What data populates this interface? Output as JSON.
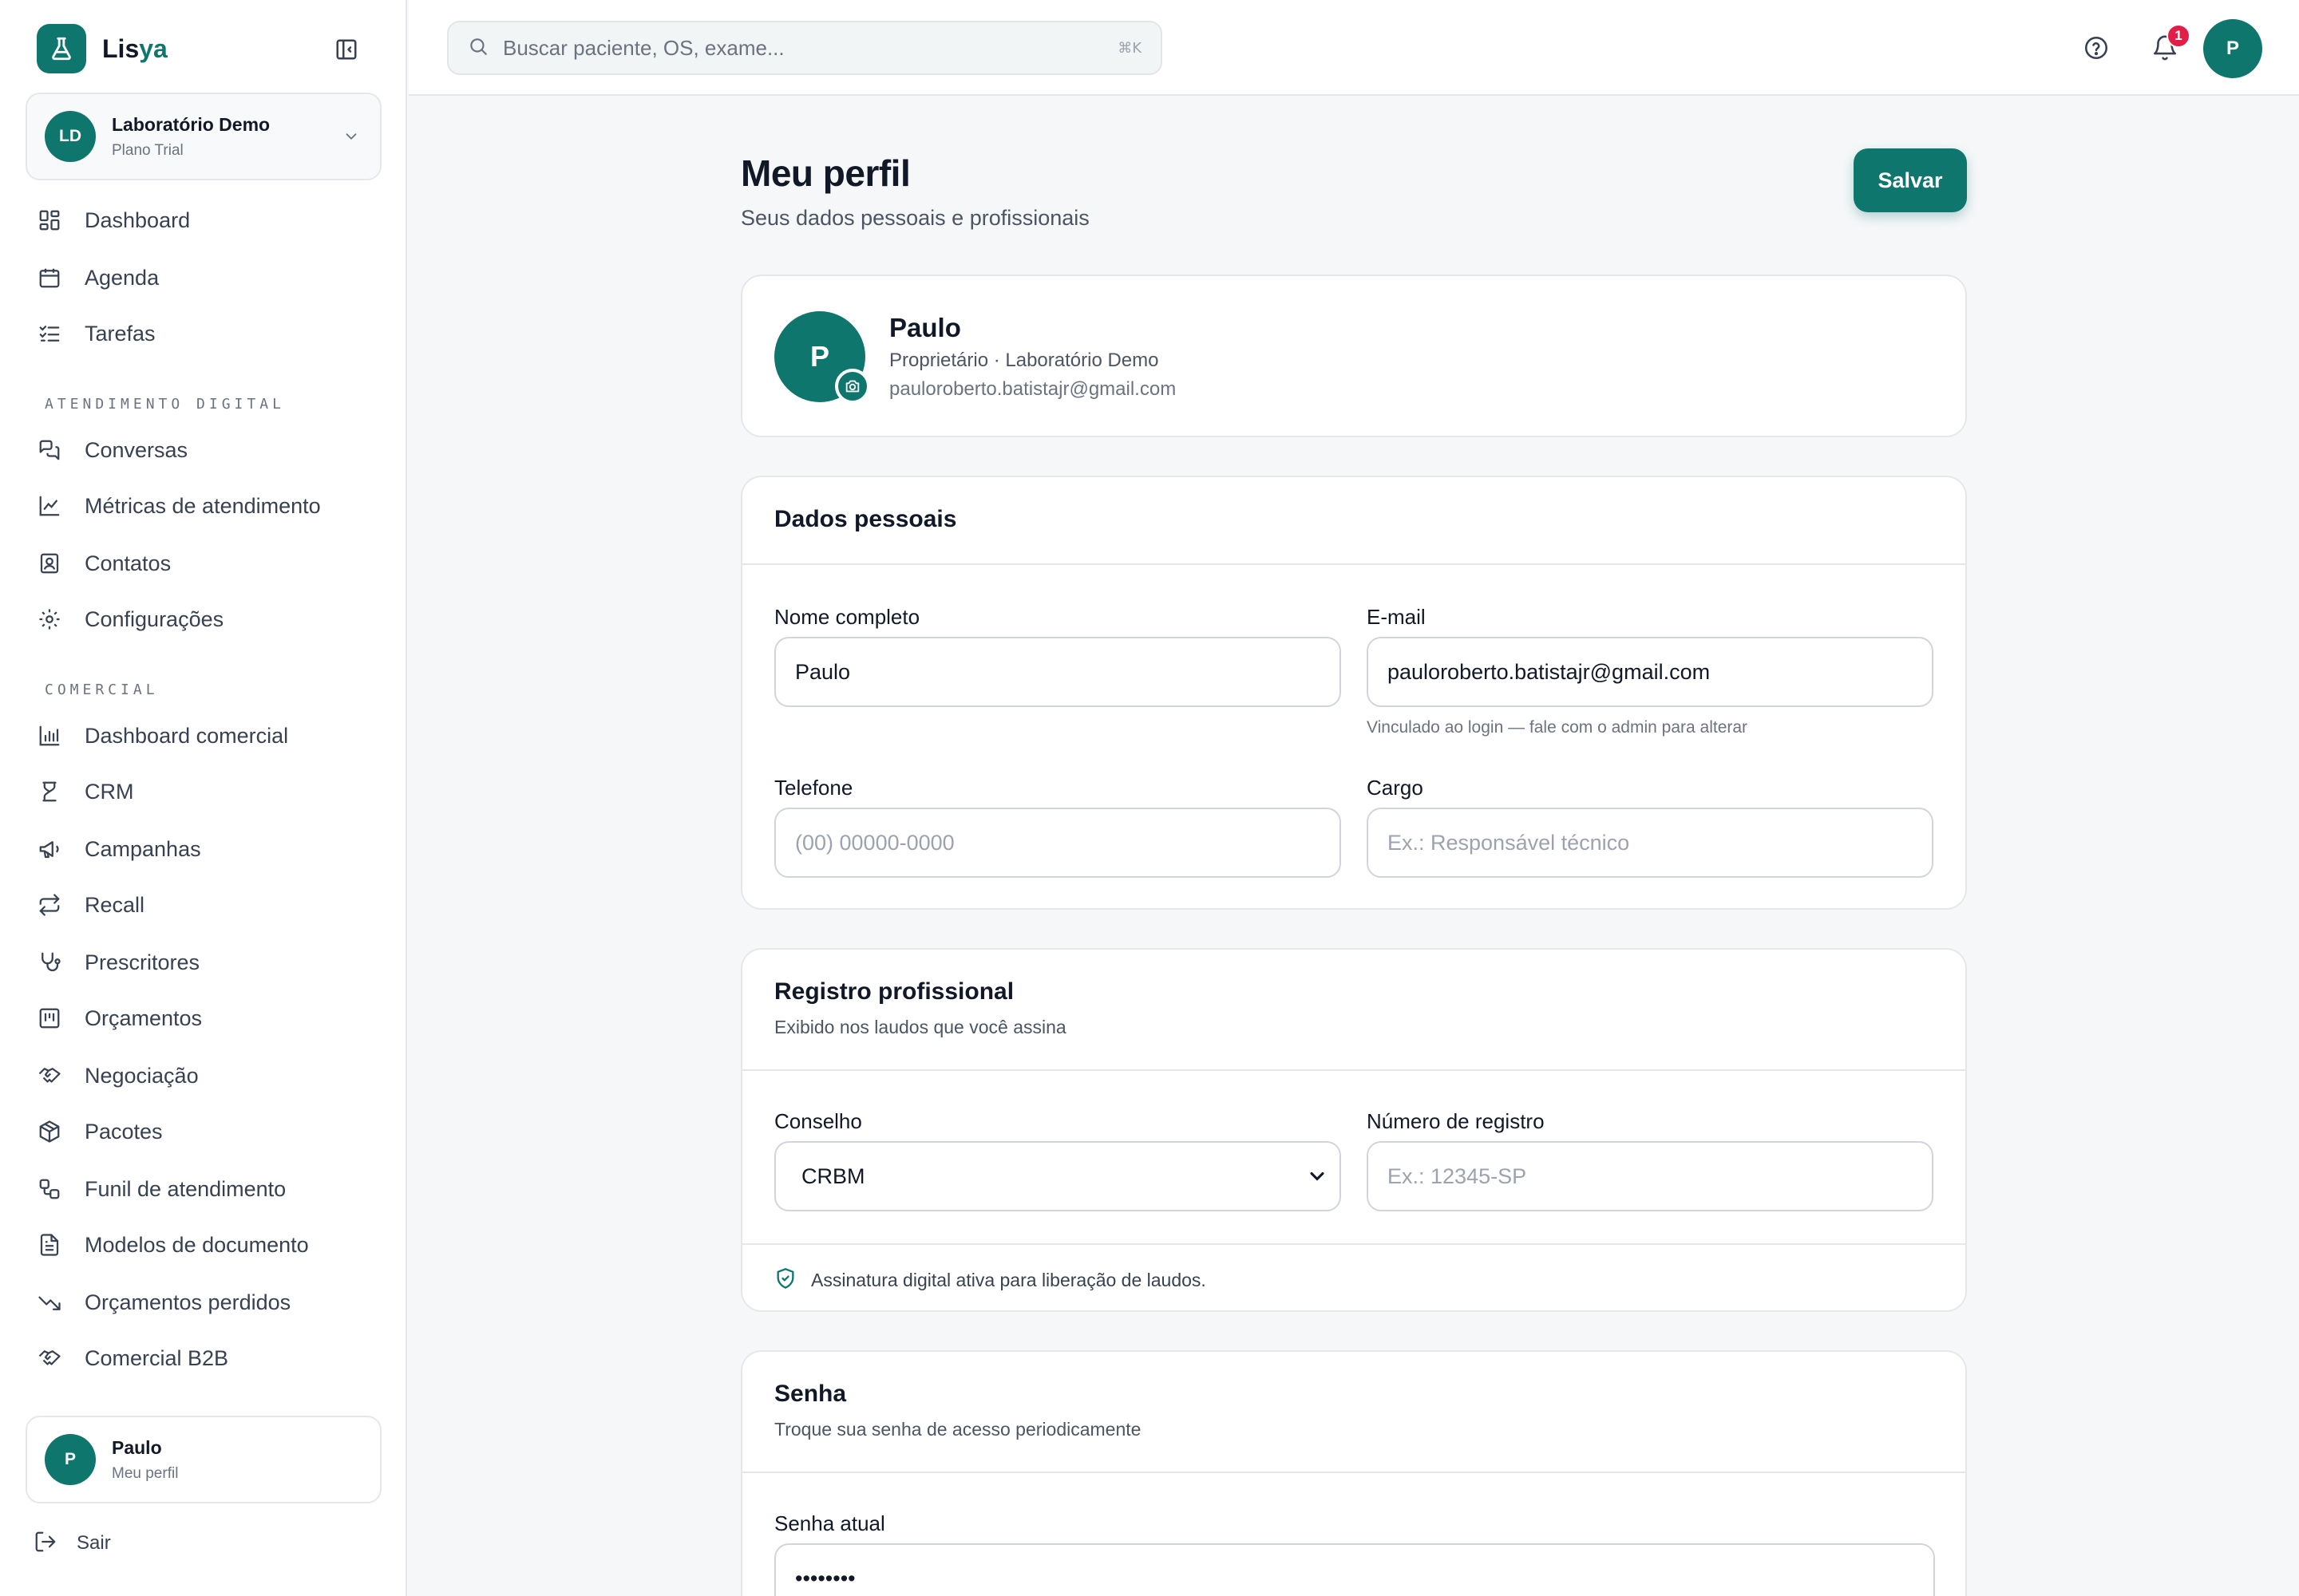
{
  "brand": {
    "name_main": "Lis",
    "name_accent": "ya"
  },
  "org": {
    "initials": "LD",
    "name": "Laboratório Demo",
    "plan": "Plano Trial"
  },
  "nav": {
    "top": [
      {
        "label": "Dashboard",
        "icon": "grid-icon"
      },
      {
        "label": "Agenda",
        "icon": "calendar-icon"
      },
      {
        "label": "Tarefas",
        "icon": "checklist-icon"
      }
    ],
    "section_digital": "ATENDIMENTO DIGITAL",
    "digital": [
      {
        "label": "Conversas",
        "icon": "chat-icon"
      },
      {
        "label": "Métricas de atendimento",
        "icon": "line-chart-icon"
      },
      {
        "label": "Contatos",
        "icon": "contact-icon"
      },
      {
        "label": "Configurações",
        "icon": "gear-icon"
      }
    ],
    "section_comercial": "COMERCIAL",
    "comercial": [
      {
        "label": "Dashboard comercial",
        "icon": "bar-chart-icon"
      },
      {
        "label": "CRM",
        "icon": "crm-icon"
      },
      {
        "label": "Campanhas",
        "icon": "megaphone-icon"
      },
      {
        "label": "Recall",
        "icon": "repeat-icon"
      },
      {
        "label": "Prescritores",
        "icon": "stethoscope-icon"
      },
      {
        "label": "Orçamentos",
        "icon": "receipt-icon"
      },
      {
        "label": "Negociação",
        "icon": "handshake-icon"
      },
      {
        "label": "Pacotes",
        "icon": "package-icon"
      },
      {
        "label": "Funil de atendimento",
        "icon": "workflow-icon"
      },
      {
        "label": "Modelos de documento",
        "icon": "document-icon"
      },
      {
        "label": "Orçamentos perdidos",
        "icon": "trending-down-icon"
      },
      {
        "label": "Comercial B2B",
        "icon": "handshake-icon"
      }
    ]
  },
  "user": {
    "initial": "P",
    "name": "Paulo",
    "link": "Meu perfil"
  },
  "logout_label": "Sair",
  "topbar": {
    "search_placeholder": "Buscar paciente, OS, exame...",
    "search_shortcut": "⌘K",
    "notification_count": "1",
    "avatar_initial": "P"
  },
  "page": {
    "title": "Meu perfil",
    "subtitle": "Seus dados pessoais e profissionais",
    "save_label": "Salvar"
  },
  "profile": {
    "initial": "P",
    "name": "Paulo",
    "role": "Proprietário · Laboratório Demo",
    "email": "pauloroberto.batistajr@gmail.com"
  },
  "personal": {
    "title": "Dados pessoais",
    "name_label": "Nome completo",
    "name_value": "Paulo",
    "email_label": "E-mail",
    "email_value": "pauloroberto.batistajr@gmail.com",
    "email_hint": "Vinculado ao login — fale com o admin para alterar",
    "phone_label": "Telefone",
    "phone_placeholder": "(00) 00000-0000",
    "role_label": "Cargo",
    "role_placeholder": "Ex.: Responsável técnico"
  },
  "registro": {
    "title": "Registro profissional",
    "desc": "Exibido nos laudos que você assina",
    "council_label": "Conselho",
    "council_value": "CRBM",
    "number_label": "Número de registro",
    "number_placeholder": "Ex.: 12345-SP",
    "signature_note": "Assinatura digital ativa para liberação de laudos."
  },
  "senha": {
    "title": "Senha",
    "desc": "Troque sua senha de acesso periodicamente",
    "current_label": "Senha atual",
    "current_value": "password"
  },
  "colors": {
    "accent": "#0f766e",
    "badge": "#e11d48"
  }
}
